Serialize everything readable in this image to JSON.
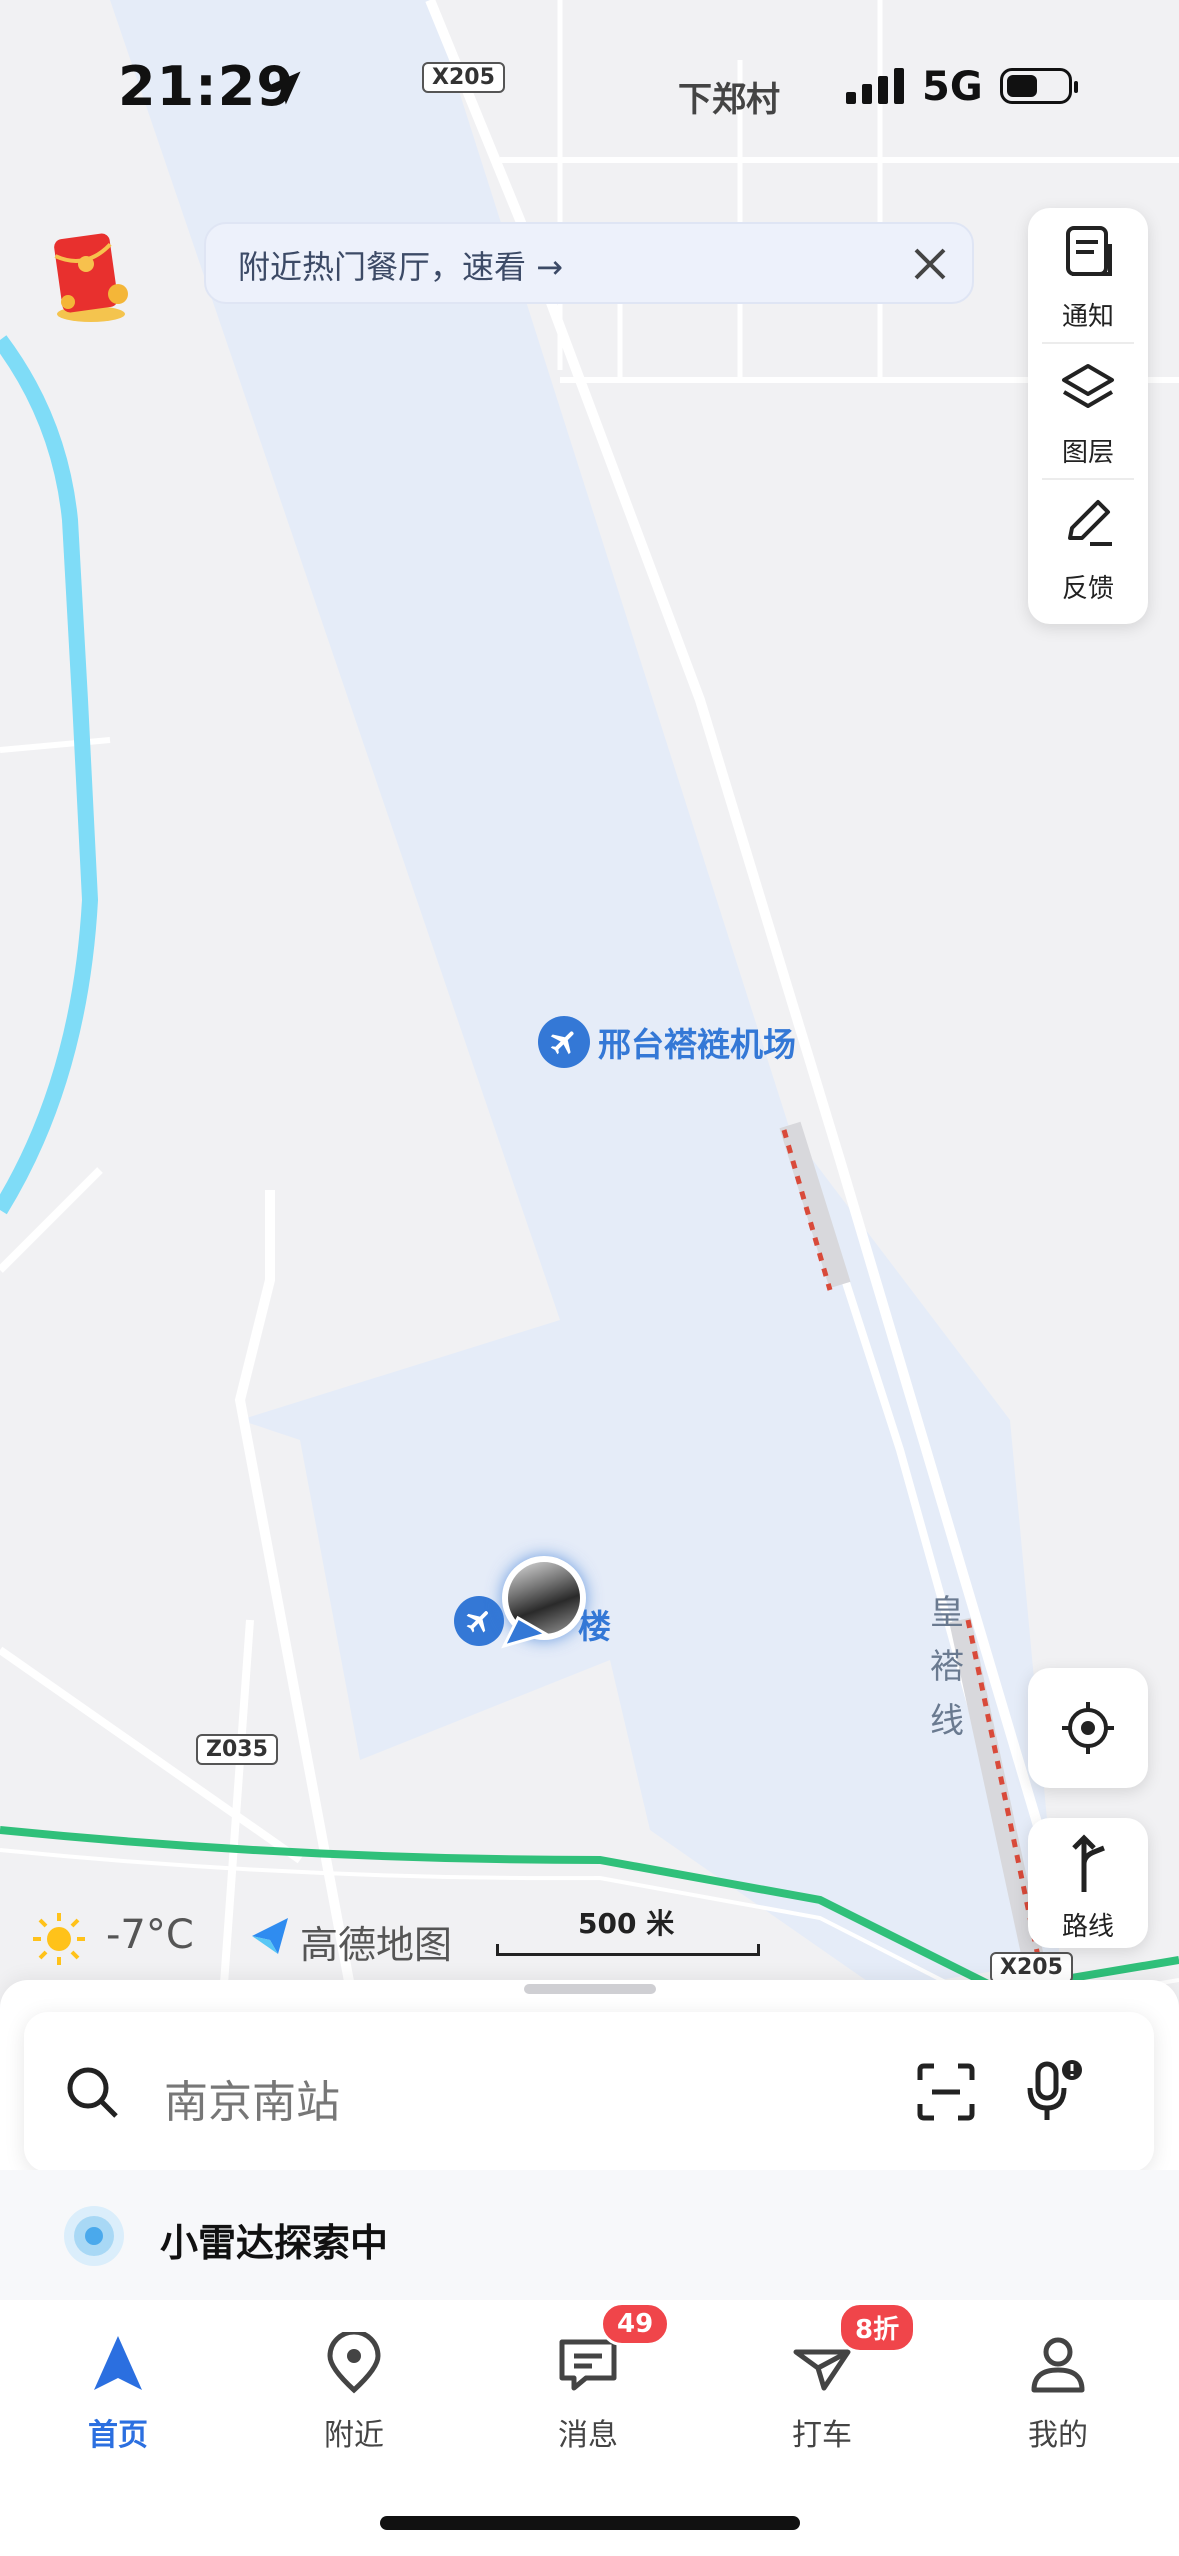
{
  "status_bar": {
    "time": "21:29",
    "network": "5G"
  },
  "map": {
    "village_label": "下郑村",
    "airport_label": "邢台褡裢机场",
    "terminal_label": "楼",
    "rail_label": "皇褡线",
    "road_shields": [
      "X205",
      "Z035",
      "X205"
    ]
  },
  "banner": {
    "text": "附近热门餐厅，速看 →"
  },
  "tools": [
    {
      "label": "通知",
      "icon": "notification-icon"
    },
    {
      "label": "图层",
      "icon": "layers-icon"
    },
    {
      "label": "反馈",
      "icon": "feedback-icon"
    }
  ],
  "route_button": {
    "label": "路线"
  },
  "weather": {
    "temperature": "-7°C"
  },
  "brand": {
    "name": "高德地图"
  },
  "scale": {
    "label": "500 米"
  },
  "search": {
    "placeholder": "南京南站"
  },
  "radar": {
    "text": "小雷达探索中"
  },
  "tabs": [
    {
      "label": "首页",
      "icon": "navigation-arrow-icon",
      "active": true
    },
    {
      "label": "附近",
      "icon": "location-pin-icon"
    },
    {
      "label": "消息",
      "icon": "message-icon",
      "badge": "49"
    },
    {
      "label": "打车",
      "icon": "taxi-icon",
      "badge": "8折"
    },
    {
      "label": "我的",
      "icon": "profile-icon"
    }
  ],
  "colors": {
    "accent": "#2b6fe0",
    "badge": "#f0454a",
    "river": "#7fdcf7",
    "rail": "#30c07a",
    "airport_area": "#e5ecf8"
  }
}
